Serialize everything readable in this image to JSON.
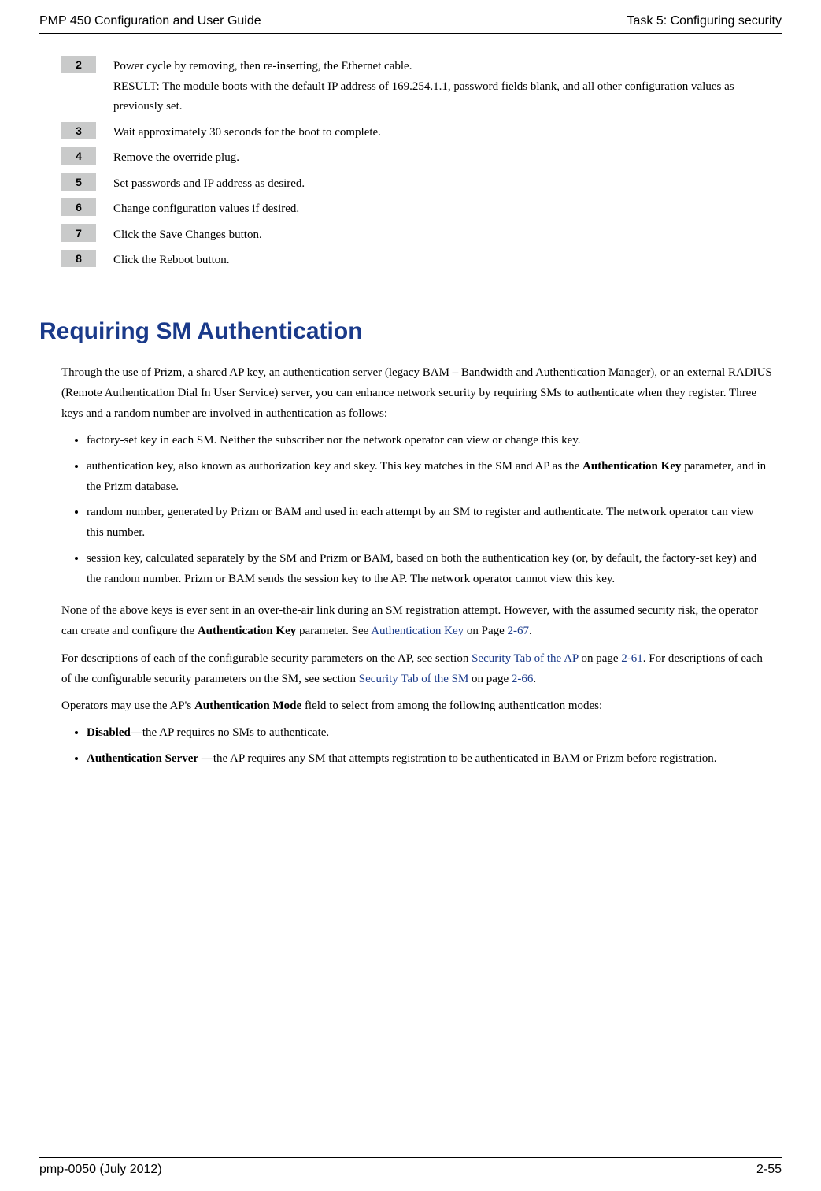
{
  "header": {
    "left": "PMP 450 Configuration and User Guide",
    "right": "Task 5: Configuring security"
  },
  "steps": [
    {
      "num": "2",
      "text": "Power cycle by removing, then re-inserting, the Ethernet cable.\nRESULT: The module boots with the default IP address of 169.254.1.1, password fields blank, and all other configuration values as previously set."
    },
    {
      "num": "3",
      "text": "Wait approximately 30 seconds for the boot to complete."
    },
    {
      "num": "4",
      "text": "Remove the override plug."
    },
    {
      "num": "5",
      "text": "Set passwords and IP address as desired."
    },
    {
      "num": "6",
      "text": "Change configuration values if desired."
    },
    {
      "num": "7",
      "text": "Click the Save Changes button."
    },
    {
      "num": "8",
      "text": "Click the Reboot button."
    }
  ],
  "section_title": "Requiring SM Authentication",
  "para1": "Through the use of Prizm, a shared AP key, an authentication server (legacy BAM – Bandwidth and Authentication Manager), or an external RADIUS (Remote Authentication Dial In User Service) server, you can enhance network security by requiring SMs to authenticate when they register. Three keys and a random number are involved in authentication as follows:",
  "bullets1": [
    "factory-set key in each SM. Neither the subscriber nor the network operator can view or change this key.",
    "authentication key, also known as authorization key and skey. This key matches in the SM and AP as the <b>Authentication Key</b> parameter, and in the Prizm database.",
    "random number, generated by Prizm or BAM and used in each attempt by an SM to register and authenticate. The network operator can view this number.",
    "session key, calculated separately by the SM and Prizm or BAM, based on both the authentication key (or, by default, the factory-set key) and the random number. Prizm or BAM sends the session key to the AP. The network operator cannot view this key."
  ],
  "para2_parts": {
    "a": "None of the above keys is ever sent in an over-the-air link during an SM registration attempt. However, with the assumed security risk, the operator can create and configure the ",
    "b": "Authentication Key",
    "c": " parameter. See ",
    "link1": "Authentication Key",
    "d": " on Page ",
    "link2": "2-67",
    "e": "."
  },
  "para3_parts": {
    "a": "For descriptions of each of the configurable security parameters on the AP, see section ",
    "link1": "Security Tab of the AP",
    "b": " on page ",
    "link2": "2-61",
    "c": ".  For descriptions of each of the configurable security parameters on the SM, see section ",
    "link3": "Security Tab of the SM",
    "d": " on page ",
    "link4": "2-66",
    "e": "."
  },
  "para4_parts": {
    "a": "Operators may use the AP's ",
    "b": "Authentication Mode",
    "c": " field to select from among the following authentication modes:"
  },
  "bullets2": [
    "<b>Disabled</b>—the AP requires no SMs to authenticate.",
    "<b>Authentication Server</b> —the AP requires any SM that attempts registration to be authenticated in BAM or Prizm before registration."
  ],
  "footer": {
    "left": "pmp-0050 (July 2012)",
    "right": "2-55"
  }
}
